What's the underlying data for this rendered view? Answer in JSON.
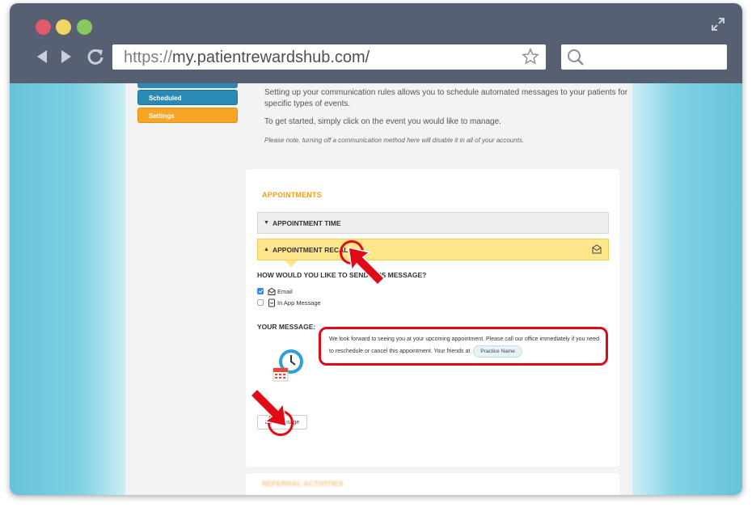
{
  "browser": {
    "url_proto": "https://",
    "url_host": "my.patientrewardshub.com/"
  },
  "sidebar": {
    "items": [
      {
        "label": "Scheduled",
        "color": "#2a8ab5"
      },
      {
        "label": "Settings",
        "color": "#f7a623"
      }
    ]
  },
  "intro": {
    "line1": "Setting up your communication rules allows you to schedule automated messages to your patients for",
    "line2": "specific types of events.",
    "line3": "To get started, simply click on the event you would like to manage.",
    "note": "Please note, turning off a communication method here will disable it in all of your accounts."
  },
  "card": {
    "section_title": "APPOINTMENTS",
    "accordion": [
      {
        "label": "APPOINTMENT TIME",
        "state": "collapsed"
      },
      {
        "label": "APPOINTMENT RECALL",
        "state": "expanded"
      }
    ],
    "question": "HOW WOULD YOU LIKE TO SEND THIS MESSAGE?",
    "options": [
      {
        "label": "Email",
        "checked": true,
        "icon": "envelope-icon"
      },
      {
        "label": "In App Message",
        "checked": false,
        "icon": "app-message-icon"
      }
    ],
    "your_message_label": "YOUR MESSAGE:",
    "message_text": "We look forward to seeing you at your upcoming appointment. Please call our office immediately if you need to reschedule or cancel this appointment. Your friends at",
    "practice_pill": "Practice Name",
    "edit_button": "Edit Message"
  },
  "card2": {
    "section_title": "REFERRAL ACTIVITIES"
  },
  "colors": {
    "accent": "#f39c20",
    "highlight": "#e00b16",
    "chrome": "#566072"
  }
}
